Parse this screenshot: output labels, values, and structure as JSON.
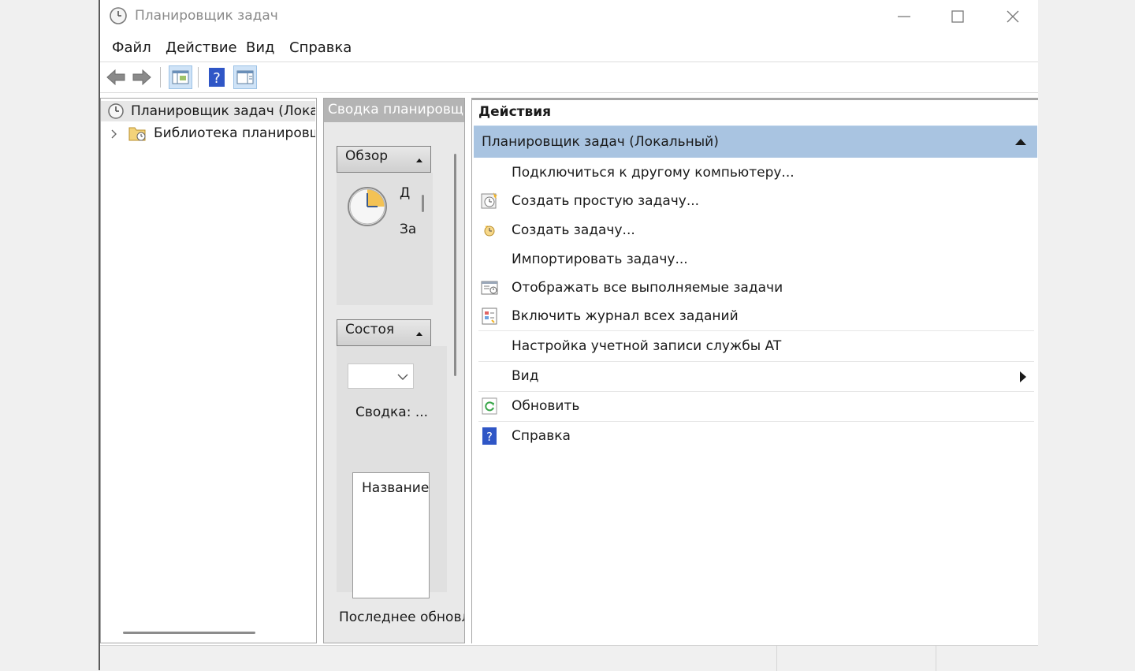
{
  "window": {
    "title": "Планировщик задач"
  },
  "menu": [
    "Файл",
    "Действие",
    "Вид",
    "Справка"
  ],
  "tree": {
    "root_label": "Планировщик задач (Локал",
    "library_label": "Библиотека планировщ"
  },
  "middle": {
    "header": "Сводка планировщи",
    "overview_label": "Обзор",
    "overview_text1": "Д",
    "overview_text2": "За",
    "status_label": "Состоя",
    "summary_label": "Сводка: ...",
    "name_column": "Название",
    "last_update": "Последнее обновл"
  },
  "actions": {
    "title": "Действия",
    "group_label": "Планировщик задач (Локальный)",
    "items": [
      {
        "label": "Подключиться к другому компьютеру...",
        "icon": "none"
      },
      {
        "label": "Создать простую задачу...",
        "icon": "create-basic-task-icon"
      },
      {
        "label": "Создать задачу...",
        "icon": "create-task-icon"
      },
      {
        "label": "Импортировать задачу...",
        "icon": "none"
      },
      {
        "label": "Отображать все выполняемые задачи",
        "icon": "running-tasks-icon"
      },
      {
        "label": "Включить журнал всех заданий",
        "icon": "history-log-icon"
      },
      {
        "label": "Настройка учетной записи службы AT",
        "icon": "none"
      },
      {
        "label": "Вид",
        "icon": "none"
      },
      {
        "label": "Обновить",
        "icon": "refresh-icon"
      },
      {
        "label": "Справка",
        "icon": "help-icon"
      }
    ]
  },
  "colors": {
    "group_header": "#a9c4e1",
    "middle_header": "#b4b4b4"
  }
}
